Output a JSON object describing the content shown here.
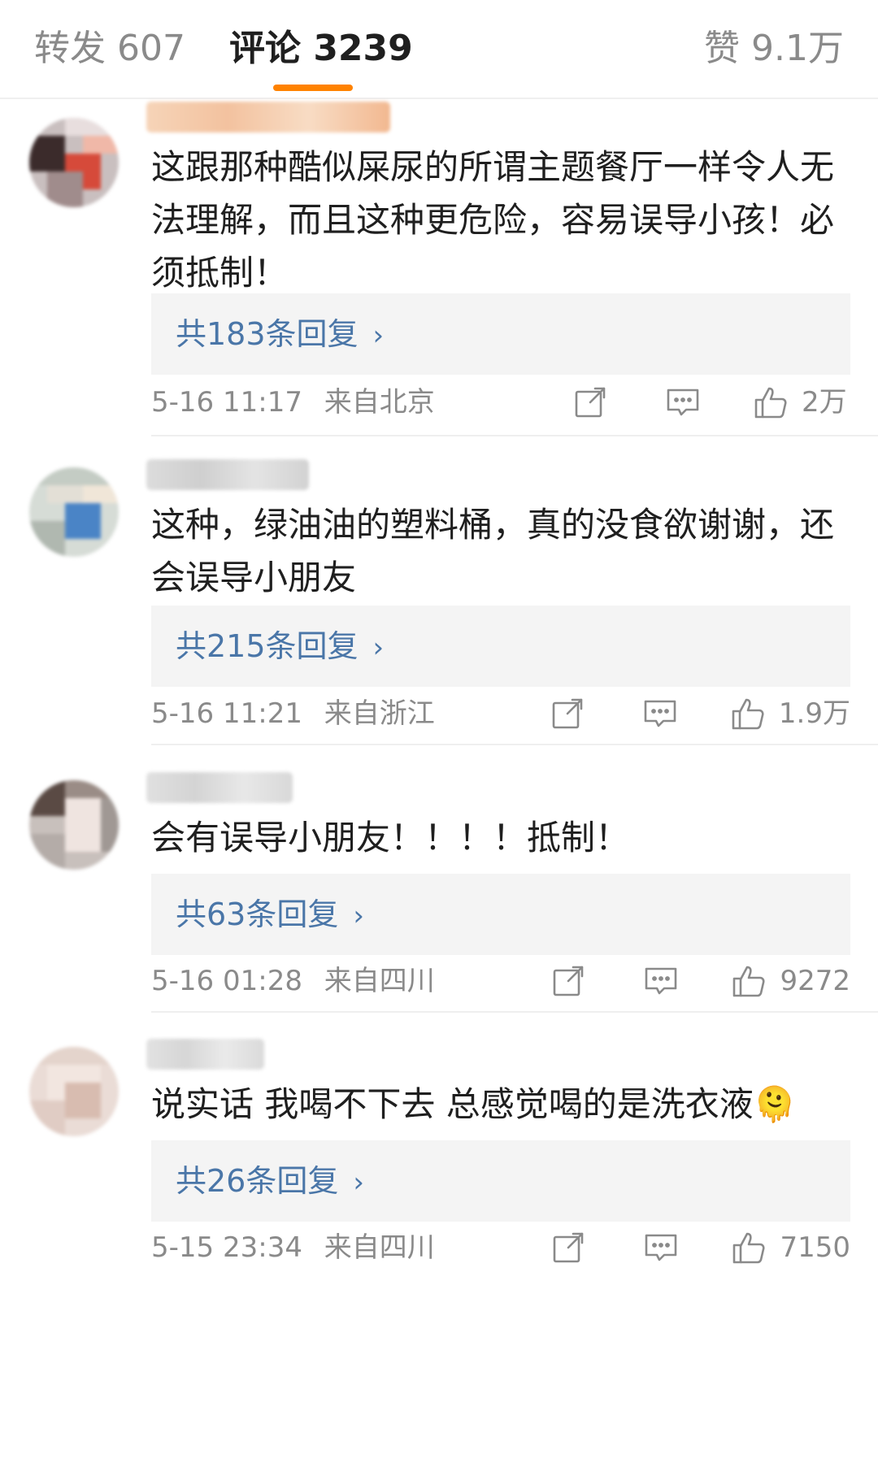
{
  "tabs": {
    "reposts": "转发 607",
    "comments": "评论 3239",
    "likes": "赞 9.1万"
  },
  "colors": {
    "accent": "#ff8200",
    "link": "#4a76a8",
    "muted": "#8a8a8a",
    "reply_bg": "#f4f4f4"
  },
  "comments": [
    {
      "text": "这跟那种酷似屎尿的所谓主题餐厅一样令人无法理解，而且这种更危险，容易误导小孩！必须抵制！",
      "replies": "共183条回复",
      "time": "5-16 11:17",
      "location": "来自北京",
      "likes": "2万"
    },
    {
      "text": "这种，绿油油的塑料桶，真的没食欲谢谢，还会误导小朋友",
      "replies": "共215条回复",
      "time": "5-16 11:21",
      "location": "来自浙江",
      "likes": "1.9万"
    },
    {
      "text": "会有误导小朋友！！！！抵制！",
      "replies": "共63条回复",
      "time": "5-16 01:28",
      "location": "来自四川",
      "likes": "9272"
    },
    {
      "text": "说实话 我喝不下去 总感觉喝的是洗衣液🫠",
      "replies": "共26条回复",
      "time": "5-15 23:34",
      "location": "来自四川",
      "likes": "7150"
    }
  ],
  "icons": {
    "share": "share-icon",
    "comment": "comment-icon",
    "like": "thumbs-up-icon",
    "chevron": "chevron-right-icon"
  }
}
